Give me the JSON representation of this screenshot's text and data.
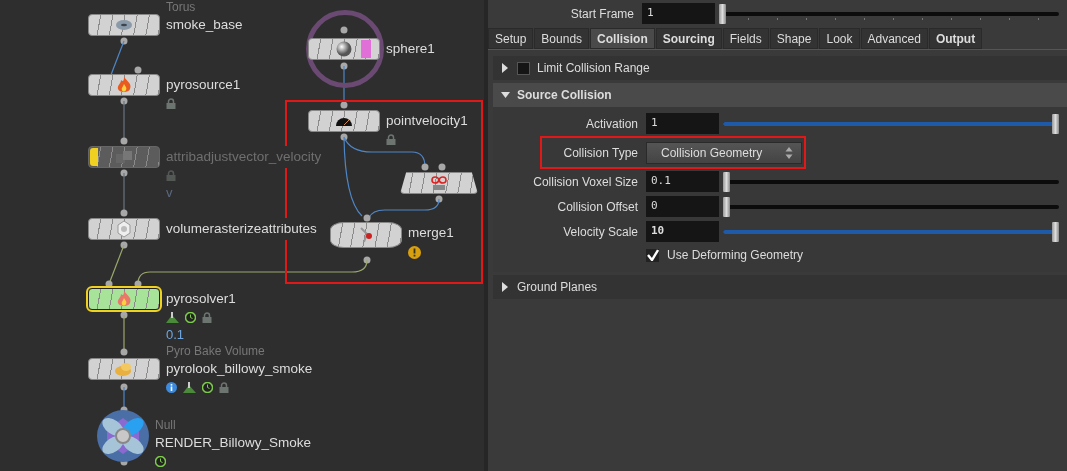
{
  "network": {
    "nodes": [
      {
        "kind": "torus",
        "subtitle": "Torus",
        "name": "smoke_base",
        "color": "#d2d2d2",
        "selected": false
      },
      {
        "kind": "pyrosource",
        "name": "pyrosource1",
        "color": "#d2d2d2",
        "selected": false,
        "badges": [
          {
            "kind": "lock"
          }
        ]
      },
      {
        "kind": "attribadjust",
        "name": "attribadjustvector_velocity",
        "extra": "v",
        "color": "#5c5c5c",
        "selected": false,
        "flags": [
          {
            "kind": "bypass"
          }
        ],
        "badges": [
          {
            "kind": "lock"
          }
        ]
      },
      {
        "kind": "rasterize",
        "name": "volumerasterizeattributes",
        "color": "#d2d2d2",
        "selected": false
      },
      {
        "kind": "pyrosolver",
        "name": "pyrosolver1",
        "extra": "0.1",
        "color": "#a8e39a",
        "selected": true,
        "badges": [
          {
            "kind": "baked"
          },
          {
            "kind": "clock"
          },
          {
            "kind": "lock"
          }
        ]
      },
      {
        "kind": "pyrolook",
        "subtitle": "Pyro Bake Volume",
        "name": "pyrolook_billowy_smoke",
        "color": "#d2d2d2",
        "selected": false,
        "badges": [
          {
            "kind": "info"
          },
          {
            "kind": "baked"
          },
          {
            "kind": "clock"
          },
          {
            "kind": "lock"
          }
        ]
      },
      {
        "kind": "null",
        "subtitle": "Null",
        "name": "RENDER_Billowy_Smoke",
        "color": "#4a6ea6",
        "selected": false,
        "badges": [
          {
            "kind": "clock"
          }
        ]
      },
      {
        "kind": "sphere",
        "name": "sphere1",
        "color": "#d2d2d2",
        "selected": false,
        "flags": [
          {
            "kind": "display"
          }
        ]
      },
      {
        "kind": "pointvelocity",
        "name": "pointvelocity1",
        "color": "#d2d2d2",
        "selected": false,
        "badges": [
          {
            "kind": "lock"
          }
        ]
      },
      {
        "kind": "trapezoid",
        "color": "#d2d2d2",
        "selected": false
      },
      {
        "kind": "merge",
        "name": "merge1",
        "color": "#d2d2d2",
        "selected": false,
        "badges": [
          {
            "kind": "warning"
          }
        ]
      }
    ]
  },
  "panel": {
    "start_frame": {
      "label": "Start Frame",
      "value": "1",
      "level": 0
    },
    "tabs": [
      {
        "label": "Setup",
        "selected": false,
        "modified": false
      },
      {
        "label": "Bounds",
        "selected": false,
        "modified": false
      },
      {
        "label": "Collision",
        "selected": true,
        "modified": true
      },
      {
        "label": "Sourcing",
        "selected": false,
        "modified": true
      },
      {
        "label": "Fields",
        "selected": false,
        "modified": false
      },
      {
        "label": "Shape",
        "selected": false,
        "modified": false
      },
      {
        "label": "Look",
        "selected": false,
        "modified": false
      },
      {
        "label": "Advanced",
        "selected": false,
        "modified": false
      },
      {
        "label": "Output",
        "selected": false,
        "modified": true
      }
    ],
    "sections": [
      {
        "title": "Limit Collision Range",
        "expanded": false,
        "checked": false
      },
      {
        "title": "Source Collision",
        "expanded": true,
        "params": [
          {
            "kind": "slider",
            "label": "Activation",
            "value": "1",
            "level": 1,
            "modified": false
          },
          {
            "kind": "menu",
            "label": "Collision Type",
            "value": "Collision Geometry",
            "highlighted": true
          },
          {
            "kind": "slider",
            "label": "Collision Voxel Size",
            "value": "0.1",
            "level": 0,
            "modified": false
          },
          {
            "kind": "slider",
            "label": "Collision Offset",
            "value": "0",
            "level": 0,
            "modified": false
          },
          {
            "kind": "slider",
            "label": "Velocity Scale",
            "value": "10",
            "level": 1,
            "modified": true
          },
          {
            "kind": "checkbox",
            "label": "Use Deforming Geometry",
            "checked": true
          }
        ]
      },
      {
        "title": "Ground Planes",
        "expanded": false
      }
    ]
  }
}
